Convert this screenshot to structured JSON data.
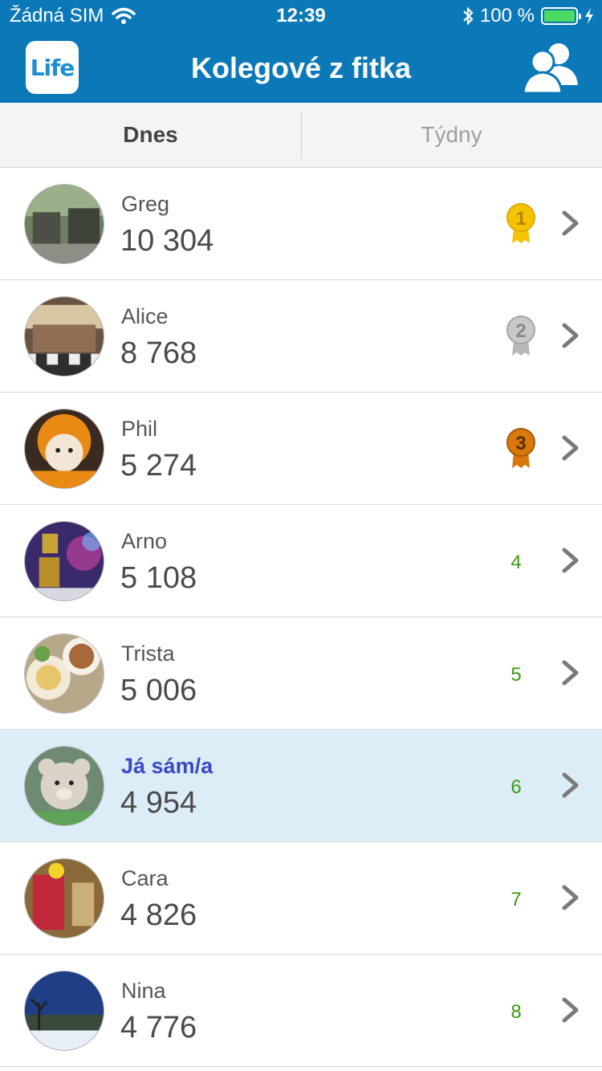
{
  "status_bar": {
    "carrier": "Žádná SIM",
    "time": "12:39",
    "battery_percent": "100 %",
    "bluetooth_icon": "bluetooth-icon",
    "wifi_icon": "wifi-icon"
  },
  "header": {
    "title": "Kolegové z fitka",
    "logo_text": "Life",
    "friends_icon": "friends-icon"
  },
  "tabs": [
    {
      "label": "Dnes",
      "active": true
    },
    {
      "label": "Týdny",
      "active": false
    }
  ],
  "colors": {
    "brand_blue": "#0b79b8",
    "highlight_row": "#dcedf8",
    "rank_green": "#3a9a0e",
    "me_name": "#3a4bc6",
    "gold": "#f5c400",
    "silver": "#b9b9b9",
    "bronze": "#d9780c"
  },
  "leaderboard": [
    {
      "name": "Greg",
      "steps": "10 304",
      "rank": "1",
      "medal": "gold",
      "is_me": false
    },
    {
      "name": "Alice",
      "steps": "8 768",
      "rank": "2",
      "medal": "silver",
      "is_me": false
    },
    {
      "name": "Phil",
      "steps": "5 274",
      "rank": "3",
      "medal": "bronze",
      "is_me": false
    },
    {
      "name": "Arno",
      "steps": "5 108",
      "rank": "4",
      "medal": null,
      "is_me": false
    },
    {
      "name": "Trista",
      "steps": "5 006",
      "rank": "5",
      "medal": null,
      "is_me": false
    },
    {
      "name": "Já sám/a",
      "steps": "4 954",
      "rank": "6",
      "medal": null,
      "is_me": true
    },
    {
      "name": "Cara",
      "steps": "4 826",
      "rank": "7",
      "medal": null,
      "is_me": false
    },
    {
      "name": "Nina",
      "steps": "4 776",
      "rank": "8",
      "medal": null,
      "is_me": false
    }
  ]
}
